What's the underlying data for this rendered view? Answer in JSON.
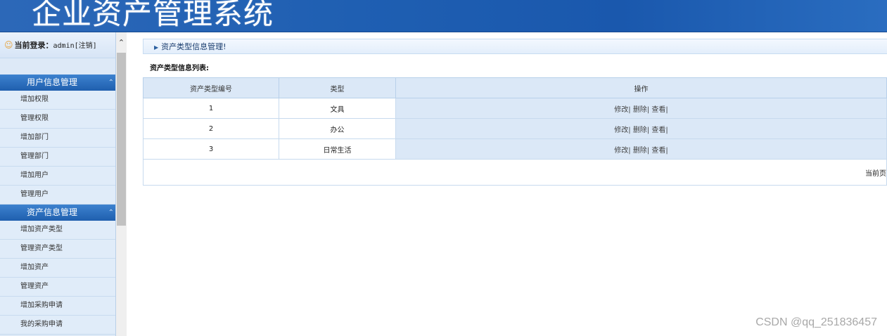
{
  "header": {
    "title": "企业资产管理系统"
  },
  "sidebar": {
    "login_label": "当前登录：",
    "login_user": "admin",
    "logout_label": "[注销]",
    "groups": [
      {
        "title": "用户信息管理",
        "items": [
          "增加权限",
          "管理权限",
          "增加部门",
          "管理部门",
          "增加用户",
          "管理用户"
        ]
      },
      {
        "title": "资产信息管理",
        "items": [
          "增加资产类型",
          "管理资产类型",
          "增加资产",
          "管理资产",
          "增加采购申请",
          "我的采购申请"
        ]
      }
    ]
  },
  "main": {
    "heading": "资产类型信息管理!",
    "list_title": "资产类型信息列表:",
    "columns": [
      "资产类型编号",
      "类型",
      "操作"
    ],
    "rows": [
      {
        "id": "1",
        "type": "文具"
      },
      {
        "id": "2",
        "type": "办公"
      },
      {
        "id": "3",
        "type": "日常生活"
      }
    ],
    "actions": {
      "edit": "修改|",
      "delete": "删除|",
      "view": "查看|"
    },
    "pager": "当前页"
  },
  "watermark": "CSDN @qq_251836457",
  "colors": {
    "header": "#1f5fb2",
    "sidebar": "#dde9f7",
    "table_header": "#dbe8f7"
  }
}
